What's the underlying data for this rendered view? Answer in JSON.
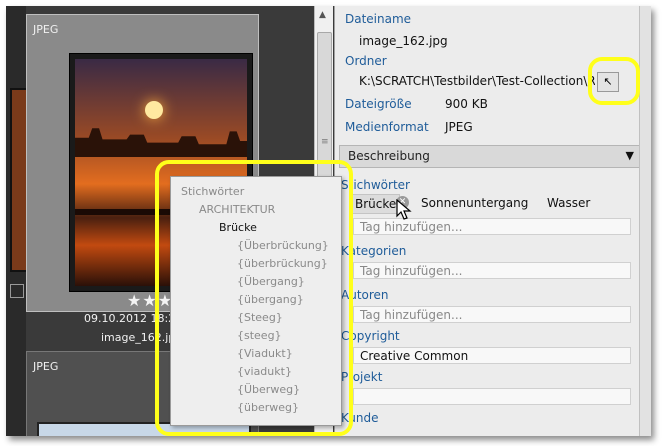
{
  "grid": {
    "thumb1": {
      "format": "JPEG",
      "rating_stars": "★★★",
      "date": "09.10.2012 18:2",
      "filename": "image_162.jpg"
    },
    "thumb2": {
      "format": "JPEG"
    }
  },
  "metadata": {
    "dateiname_label": "Dateiname",
    "dateiname_value": "image_162.jpg",
    "ordner_label": "Ordner",
    "ordner_value": "K:\\SCRATCH\\Testbilder\\Test-Collection\\Rese",
    "dateigroesse_label": "Dateigröße",
    "dateigroesse_value": "900 KB",
    "medienformat_label": "Medienformat",
    "medienformat_value": "JPEG"
  },
  "beschreibung": {
    "header": "Beschreibung",
    "stichwoerter_label": "Stichwörter",
    "tags": [
      "Brücke",
      "Sonnenuntergang",
      "Wasser"
    ],
    "tag_placeholder": "Tag hinzufügen...",
    "kategorien_label": "Kategorien",
    "autoren_label": "Autoren",
    "copyright_label": "Copyright",
    "copyright_value": "Creative Common",
    "projekt_label": "Projekt",
    "kunde_label": "Kunde"
  },
  "popup": {
    "root": "Stichwörter",
    "level1": "ARCHITEKTUR",
    "level2": "Brücke",
    "synonyms": [
      "{Überbrückung}",
      "{überbrückung}",
      "{Übergang}",
      "{übergang}",
      "{Steeg}",
      "{steeg}",
      "{Viadukt}",
      "{viadukt}",
      "{Überweg}",
      "{überweg}"
    ]
  },
  "colors": {
    "highlight": "#ffff1a",
    "label_blue": "#1f5c99"
  }
}
